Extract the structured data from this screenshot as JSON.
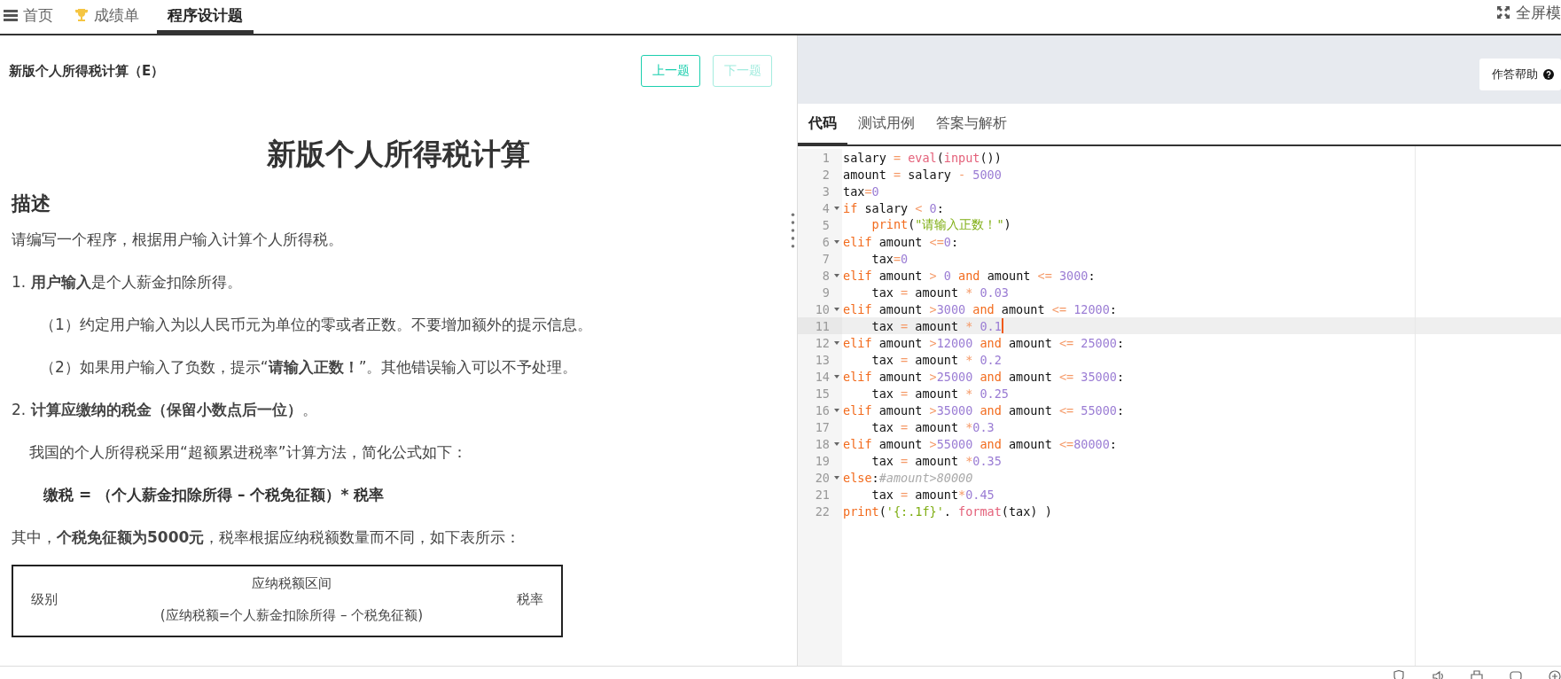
{
  "nav": {
    "tabs": [
      {
        "label": "首页",
        "selected": false
      },
      {
        "label": "成绩单",
        "selected": false
      },
      {
        "label": "程序设计题",
        "selected": true
      }
    ],
    "fullscreen": "全屏模"
  },
  "problem": {
    "title": "新版个人所得税计算（E）",
    "prev": {
      "label": "上一题",
      "disabled": false
    },
    "next": {
      "label": "下一题",
      "disabled": true
    },
    "heading": "新版个人所得税计算",
    "section": "描述",
    "paragraphs": [
      {
        "kind": "p",
        "text": "请编写一个程序，根据用户输入计算个人所得税。"
      },
      {
        "kind": "p",
        "text": "1. **用户输入**是个人薪金扣除所得。"
      },
      {
        "kind": "indent2",
        "text": "（1）约定用户输入为以人民币元为单位的零或者正数。不要增加额外的提示信息。"
      },
      {
        "kind": "indent2",
        "text": "（2）如果用户输入了负数，提示“**请输入正数！**”。其他错误输入可以不予处理。"
      },
      {
        "kind": "p",
        "text": "2. **计算应缴纳的税金（保留小数点后一位）**。"
      },
      {
        "kind": "indent1",
        "text": "我国的个人所得税采用“超额累进税率”计算方法，简化公式如下："
      },
      {
        "kind": "formula",
        "text": "缴税 = （个人薪金扣除所得 – 个税免征额）* 税率"
      },
      {
        "kind": "p",
        "text": "其中，**个税免征额为5000元**，税率根据应纳税额数量而不同，如下表所示："
      }
    ],
    "table": {
      "columns": [
        {
          "lines": [
            "级别"
          ]
        },
        {
          "lines": [
            "应纳税额区间",
            "(应纳税额=个人薪金扣除所得 – 个税免征额)"
          ]
        },
        {
          "lines": [
            "税率"
          ]
        }
      ]
    }
  },
  "editor": {
    "help": "作答帮助",
    "tabs": [
      {
        "label": "代码",
        "selected": true
      },
      {
        "label": "测试用例",
        "selected": false
      },
      {
        "label": "答案与解析",
        "selected": false
      }
    ],
    "lines": [
      {
        "number": "1",
        "fold": false,
        "indented": false,
        "active": false,
        "text": "salary = eval(input())"
      },
      {
        "number": "2",
        "fold": false,
        "indented": false,
        "active": false,
        "text": "amount = salary - 5000"
      },
      {
        "number": "3",
        "fold": false,
        "indented": false,
        "active": false,
        "text": "tax=0"
      },
      {
        "number": "4",
        "fold": true,
        "indented": false,
        "active": false,
        "text": "if salary < 0:"
      },
      {
        "number": "5",
        "fold": false,
        "indented": true,
        "active": false,
        "text": "print(\"请输入正数！\")"
      },
      {
        "number": "6",
        "fold": true,
        "indented": false,
        "active": false,
        "text": "elif amount <=0:"
      },
      {
        "number": "7",
        "fold": false,
        "indented": true,
        "active": false,
        "text": "tax=0"
      },
      {
        "number": "8",
        "fold": true,
        "indented": false,
        "active": false,
        "text": "elif amount > 0 and amount <= 3000:"
      },
      {
        "number": "9",
        "fold": false,
        "indented": true,
        "active": false,
        "text": "tax = amount * 0.03"
      },
      {
        "number": "10",
        "fold": true,
        "indented": false,
        "active": false,
        "text": "elif amount >3000 and amount <= 12000:"
      },
      {
        "number": "11",
        "fold": false,
        "indented": true,
        "active": true,
        "text": "tax = amount * 0.1"
      },
      {
        "number": "12",
        "fold": true,
        "indented": false,
        "active": false,
        "text": "elif amount >12000 and amount <= 25000:"
      },
      {
        "number": "13",
        "fold": false,
        "indented": true,
        "active": false,
        "text": "tax = amount * 0.2"
      },
      {
        "number": "14",
        "fold": true,
        "indented": false,
        "active": false,
        "text": "elif amount >25000 and amount <= 35000:"
      },
      {
        "number": "15",
        "fold": false,
        "indented": true,
        "active": false,
        "text": "tax = amount * 0.25"
      },
      {
        "number": "16",
        "fold": true,
        "indented": false,
        "active": false,
        "text": "elif amount >35000 and amount <= 55000:"
      },
      {
        "number": "17",
        "fold": false,
        "indented": true,
        "active": false,
        "text": "tax = amount *0.3"
      },
      {
        "number": "18",
        "fold": true,
        "indented": false,
        "active": false,
        "text": "elif amount >55000 and amount <=80000:"
      },
      {
        "number": "19",
        "fold": false,
        "indented": true,
        "active": false,
        "text": "tax = amount *0.35"
      },
      {
        "number": "20",
        "fold": true,
        "indented": false,
        "active": false,
        "text": "else:#amount>80000"
      },
      {
        "number": "21",
        "fold": false,
        "indented": true,
        "active": false,
        "text": "tax = amount*0.45"
      },
      {
        "number": "22",
        "fold": false,
        "indented": false,
        "active": false,
        "text": "print('{:.1f}'. format(tax) )"
      }
    ]
  }
}
